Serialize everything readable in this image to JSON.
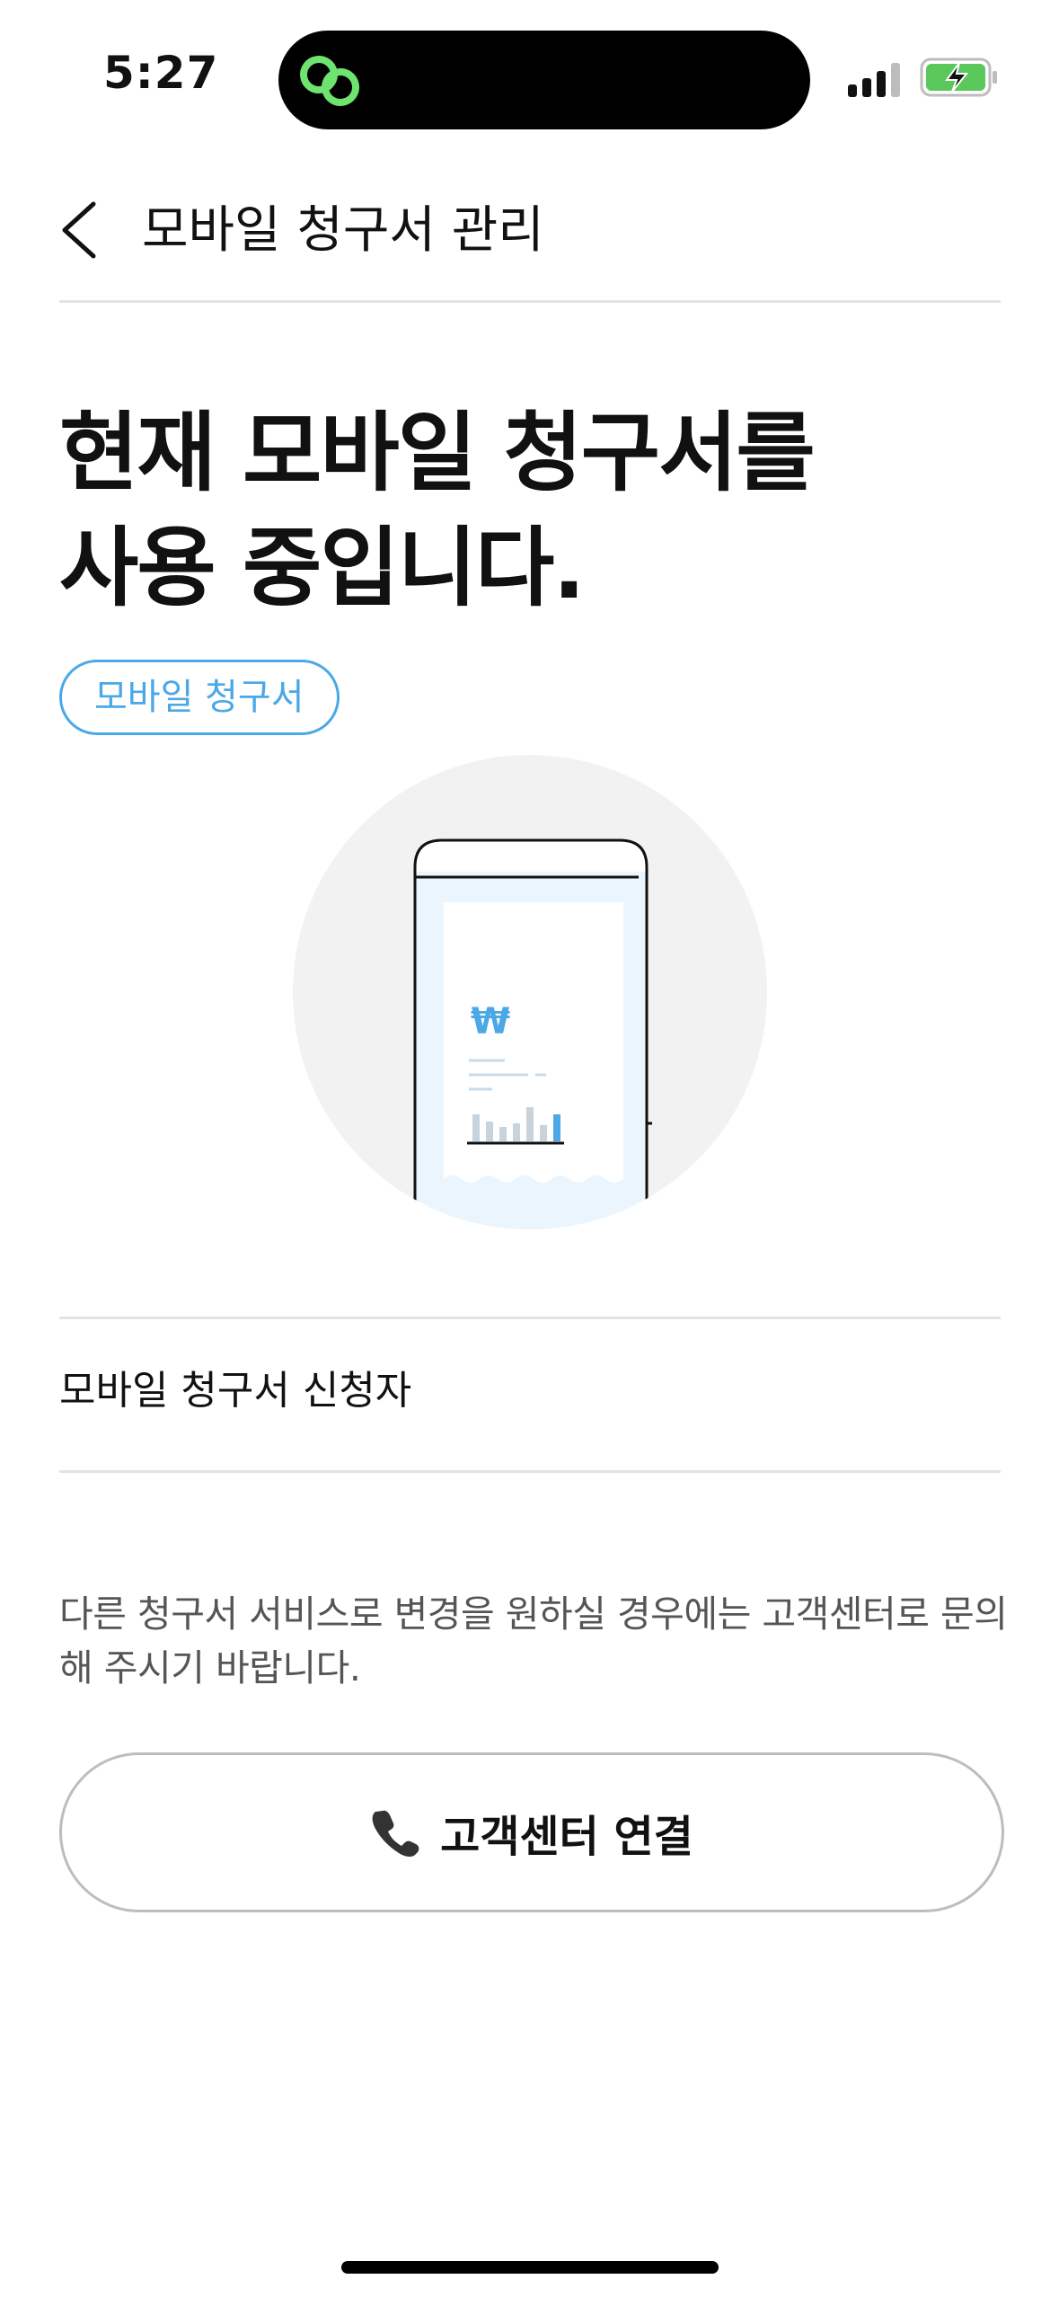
{
  "status_bar": {
    "time": "5:27",
    "icons": [
      "link-icon",
      "signal-icon",
      "battery-charging-icon"
    ]
  },
  "header": {
    "back_icon": "chevron-left-icon",
    "title": "모바일 청구서 관리"
  },
  "headline": {
    "line1": "현재 모바일 청구서를",
    "line2": "사용 중입니다."
  },
  "tag": {
    "label": "모바일 청구서"
  },
  "illustration": {
    "currency_symbol": "₩"
  },
  "info": {
    "applicant_label": "모바일 청구서 신청자"
  },
  "notice": {
    "text": "다른 청구서 서비스로 변경을 원하실 경우에는 고객센터로 문의해 주시기 바랍니다."
  },
  "call_button": {
    "icon": "phone-icon",
    "label": "고객센터 연결"
  },
  "colors": {
    "accent": "#4aa8e6",
    "text": "#111111",
    "muted_text": "#555555",
    "divider": "#e3e3e3",
    "battery_green": "#5ac85a",
    "link_green": "#6fe36f"
  }
}
